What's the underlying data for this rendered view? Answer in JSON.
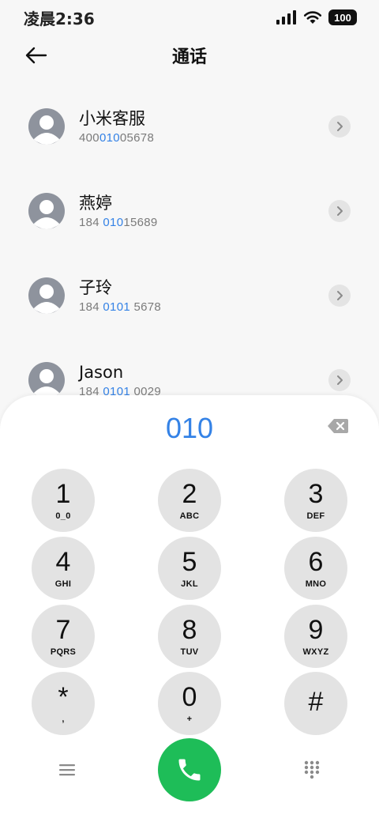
{
  "status_bar": {
    "time": "凌晨2:36",
    "battery": "100"
  },
  "header": {
    "title": "通话"
  },
  "contacts": [
    {
      "name": "小米客服",
      "number_parts": [
        "400",
        "010",
        "05678"
      ]
    },
    {
      "name": "燕婷",
      "number_parts": [
        "184 ",
        "010",
        "15689"
      ]
    },
    {
      "name": "子玲",
      "number_parts": [
        "184 ",
        "0101",
        " 5678"
      ]
    },
    {
      "name": "Jason",
      "number_parts": [
        "184 ",
        "0101",
        " 0029"
      ]
    }
  ],
  "dialer": {
    "display_value": "010",
    "keys": [
      {
        "digit": "1",
        "letters": "0_0"
      },
      {
        "digit": "2",
        "letters": "ABC"
      },
      {
        "digit": "3",
        "letters": "DEF"
      },
      {
        "digit": "4",
        "letters": "GHI"
      },
      {
        "digit": "5",
        "letters": "JKL"
      },
      {
        "digit": "6",
        "letters": "MNO"
      },
      {
        "digit": "7",
        "letters": "PQRS"
      },
      {
        "digit": "8",
        "letters": "TUV"
      },
      {
        "digit": "9",
        "letters": "WXYZ"
      },
      {
        "digit": "*",
        "letters": ","
      },
      {
        "digit": "0",
        "letters": "+"
      },
      {
        "digit": "#",
        "letters": ""
      }
    ]
  },
  "icons": {
    "back": "arrow-left-icon",
    "chevron": "chevron-right-icon",
    "backspace": "backspace-icon",
    "menu": "menu-icon",
    "call": "phone-icon",
    "keypad": "keypad-grid-icon"
  },
  "colors": {
    "accent": "#3482e6",
    "call_green": "#1ebd58",
    "key_bg": "#e3e3e3",
    "avatar": "#8e939d"
  }
}
